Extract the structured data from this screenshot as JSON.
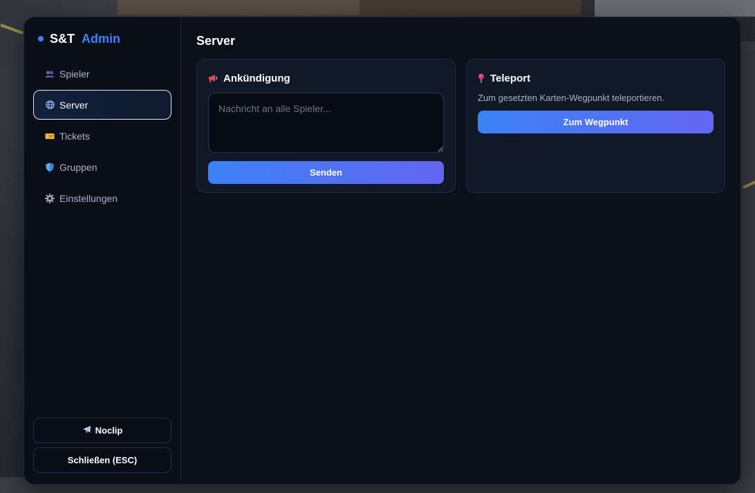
{
  "app": {
    "brand_name": "S&T",
    "brand_accent": "Admin",
    "accent_color": "#3b82f6"
  },
  "sidebar": {
    "items": [
      {
        "label": "Spieler",
        "icon": "people-icon",
        "active": false
      },
      {
        "label": "Server",
        "icon": "globe-icon",
        "active": true
      },
      {
        "label": "Tickets",
        "icon": "ticket-icon",
        "active": false
      },
      {
        "label": "Gruppen",
        "icon": "shield-icon",
        "active": false
      },
      {
        "label": "Einstellungen",
        "icon": "gear-icon",
        "active": false
      }
    ],
    "noclip_label": "Noclip",
    "noclip_icon": "airplane-icon",
    "close_label": "Schließen (ESC)"
  },
  "main": {
    "title": "Server",
    "announcement": {
      "title": "Ankündigung",
      "icon": "megaphone-icon",
      "placeholder": "Nachricht an alle Spieler...",
      "value": "",
      "button_label": "Senden"
    },
    "teleport": {
      "title": "Teleport",
      "icon": "pin-icon",
      "description": "Zum gesetzten Karten-Wegpunkt teleportieren.",
      "button_label": "Zum Wegpunkt"
    }
  }
}
